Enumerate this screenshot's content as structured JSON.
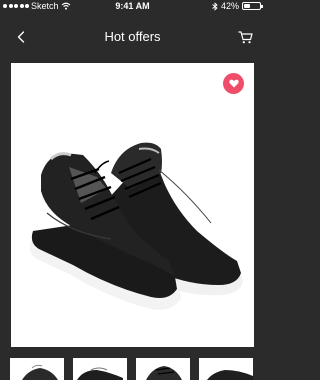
{
  "status_bar": {
    "carrier": "Sketch",
    "time": "9:41 AM",
    "battery": "42%",
    "battery_level": 0.42,
    "icons": [
      "signal-dots-icon",
      "wifi-icon",
      "bluetooth-icon",
      "battery-icon"
    ]
  },
  "nav": {
    "title": "Hot offers",
    "back_icon": "back-chevron-icon",
    "cart_icon": "cart-icon"
  },
  "product": {
    "favorite_icon": "heart-icon",
    "favorited": true,
    "image": "black-sneakers-photo"
  },
  "thumbnails": [
    {
      "image": "sneaker-thumbnail-1"
    },
    {
      "image": "sneaker-thumbnail-2"
    },
    {
      "image": "sneaker-thumbnail-3"
    },
    {
      "image": "sneaker-thumbnail-4"
    }
  ],
  "colors": {
    "background": "#2b2b2b",
    "favorite": "#ef4d6a",
    "card": "#ffffff"
  }
}
